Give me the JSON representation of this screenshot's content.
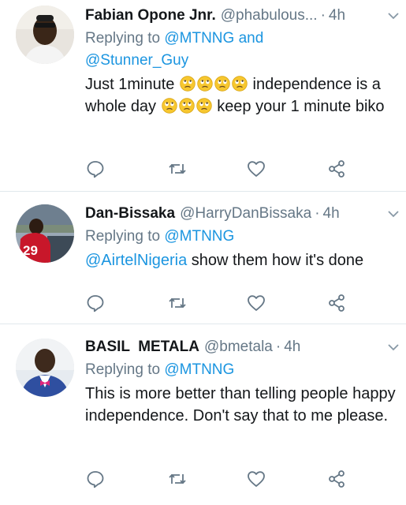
{
  "tweets": [
    {
      "name": "Fabian Opone Jnr.",
      "handle": "@phabulous...",
      "time": "4h",
      "replying_prefix": "Replying to ",
      "replying_to_1": "@MTNNG",
      "replying_and": " and",
      "replying_to_2": "@Stunner_Guy",
      "text_part1": "Just 1minute",
      "text_part2": "independence is a whole day",
      "text_part3": "keep your 1 minute biko",
      "emoji": "rolling-eyes-face"
    },
    {
      "name": "Dan-Bissaka",
      "handle": "@HarryDanBissaka",
      "time": "4h",
      "replying_prefix": "Replying to ",
      "replying_to_1": "@MTNNG",
      "mention": "@AirtelNigeria",
      "text": " show them how it's done",
      "jersey_number": "29"
    },
    {
      "name": "BASIL  METALA",
      "handle": "@bmetala",
      "time": "4h",
      "replying_prefix": "Replying to ",
      "replying_to_1": "@MTNNG",
      "text": "This is more better than telling people happy independence. Don't say that to me please."
    }
  ],
  "separator": "·",
  "icons": {
    "reply": "reply-icon",
    "retweet": "retweet-icon",
    "like": "heart-icon",
    "share": "share-icon",
    "menu": "chevron-down-icon"
  },
  "colors": {
    "link": "#1b95e0",
    "secondary": "#657786",
    "icon": "#657786"
  }
}
